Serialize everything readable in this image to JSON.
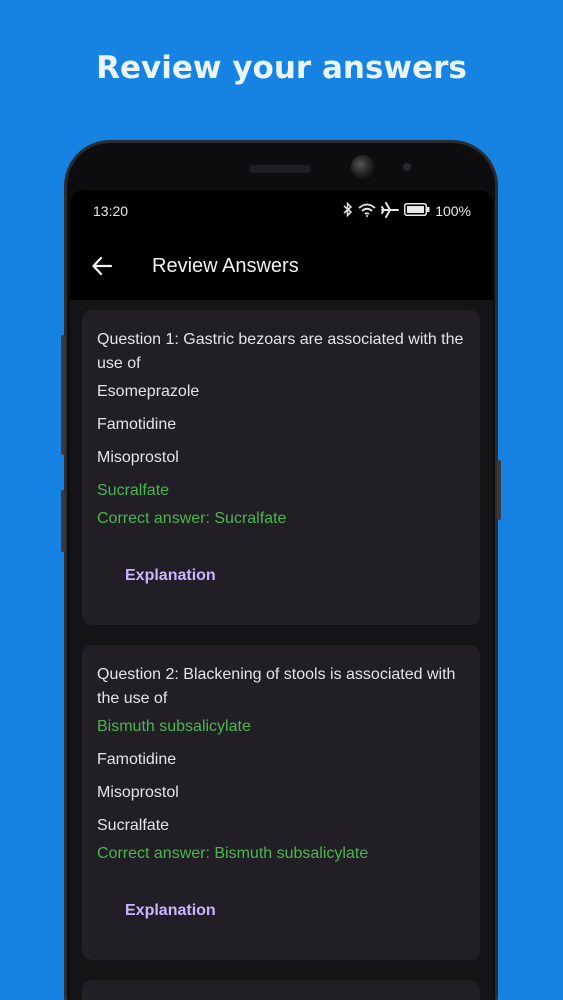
{
  "headline": "Review your answers",
  "status": {
    "time": "13:20",
    "battery": "100%"
  },
  "appbar": {
    "title": "Review Answers"
  },
  "questions": [
    {
      "text": "Question 1: Gastric bezoars are associated with the use of",
      "options": [
        "Esomeprazole",
        "Famotidine",
        "Misoprostol",
        "Sucralfate"
      ],
      "correct_index": 3,
      "answer": "Correct answer: Sucralfate",
      "button": "Explanation"
    },
    {
      "text": "Question 2: Blackening of stools is associated with the use of",
      "options": [
        "Bismuth subsalicylate",
        "Famotidine",
        "Misoprostol",
        "Sucralfate"
      ],
      "correct_index": 0,
      "answer": "Correct answer: Bismuth subsalicylate",
      "button": "Explanation"
    }
  ],
  "colors": {
    "background": "#1683e3",
    "correct": "#4cb550",
    "button_text": "#cbb5ff"
  },
  "icons": [
    "bluetooth-icon",
    "wifi-icon",
    "airplane-icon",
    "battery-icon",
    "back-arrow-icon"
  ]
}
